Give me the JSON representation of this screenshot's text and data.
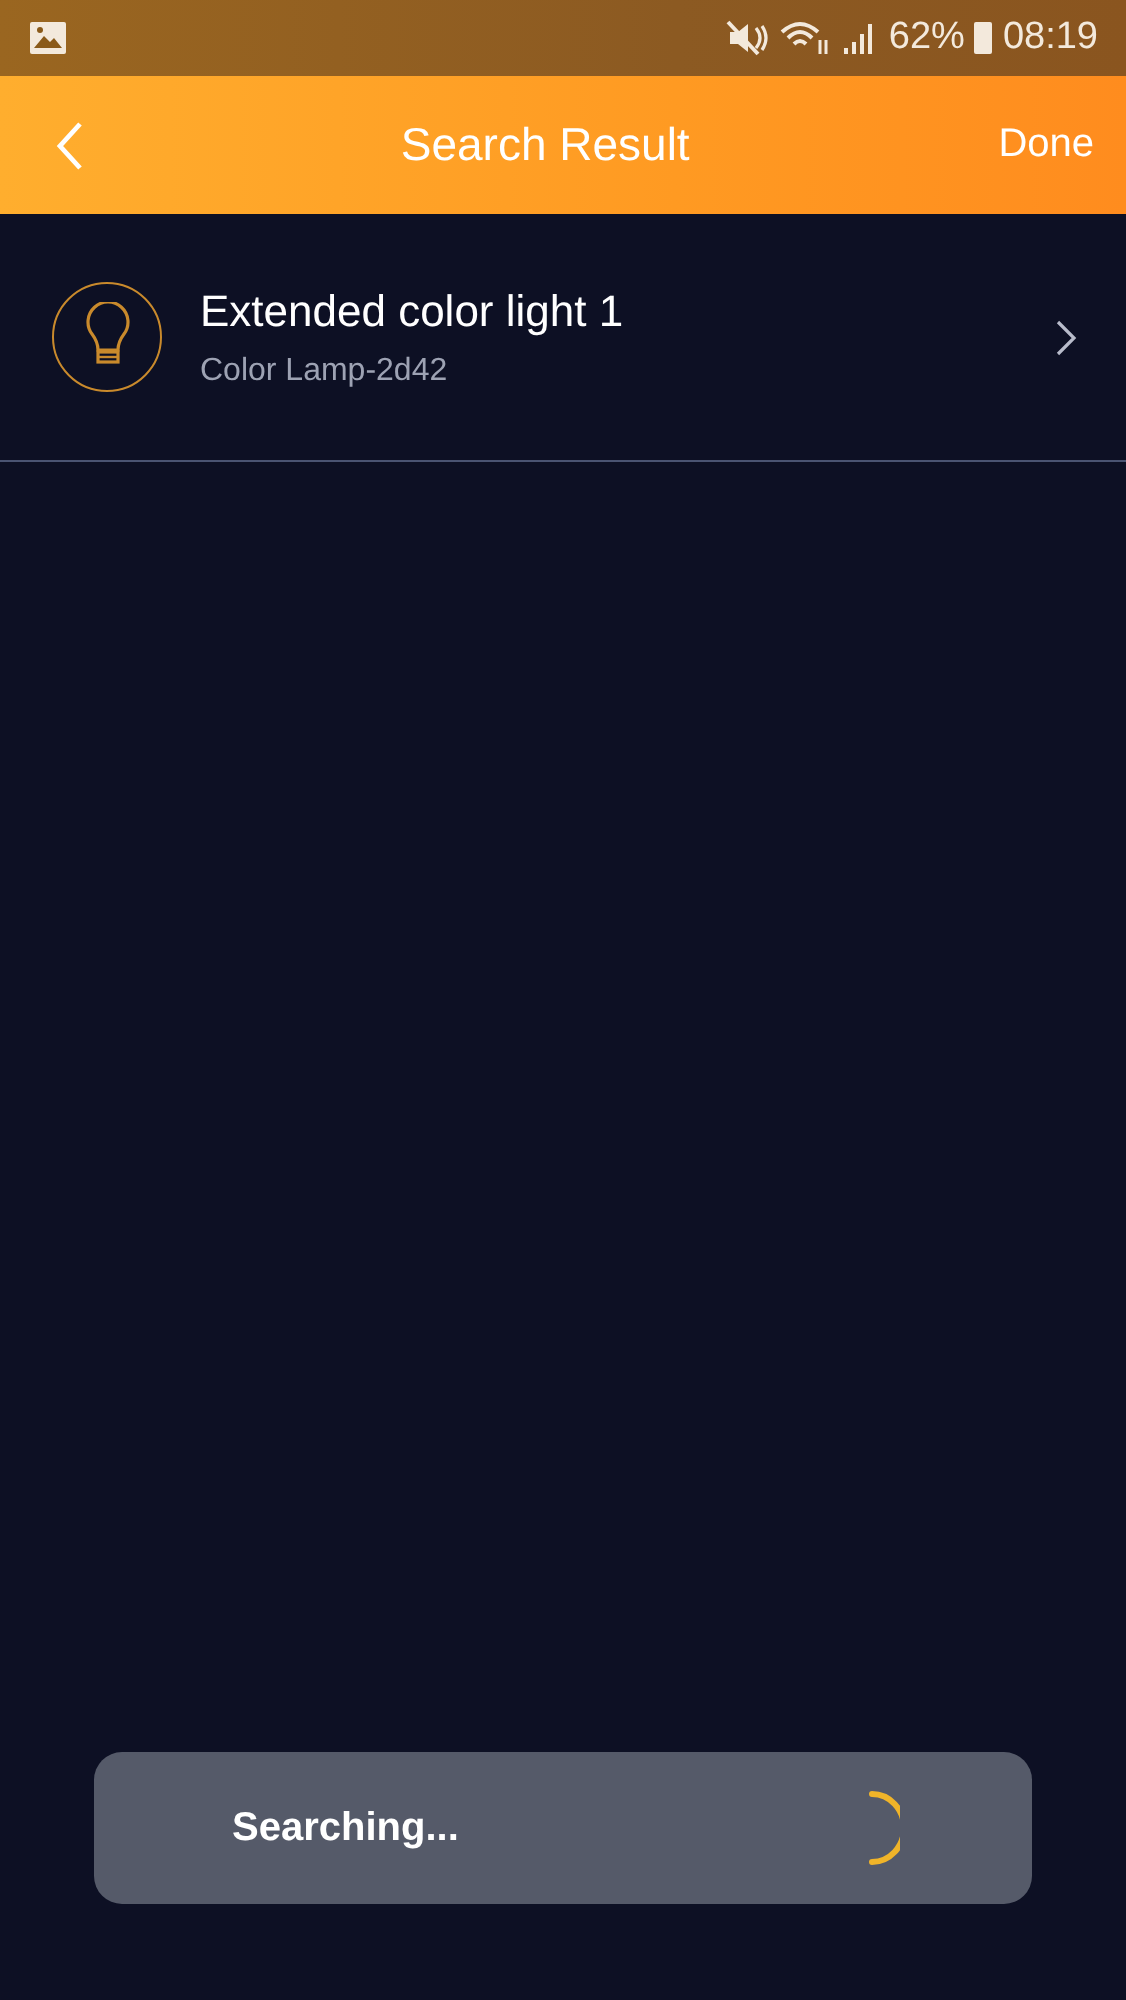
{
  "status_bar": {
    "battery": "62%",
    "time": "08:19"
  },
  "header": {
    "title": "Search Result",
    "action": "Done"
  },
  "devices": [
    {
      "name": "Extended color light 1",
      "model": "Color Lamp-2d42"
    }
  ],
  "toast": {
    "message": "Searching..."
  }
}
